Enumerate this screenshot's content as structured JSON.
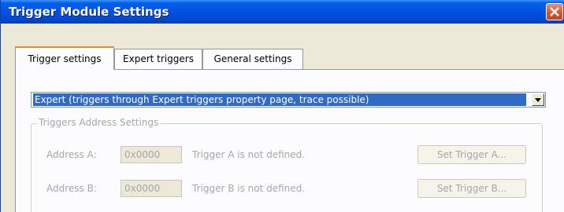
{
  "window": {
    "title": "Trigger Module Settings"
  },
  "tabs": [
    {
      "label": "Trigger settings"
    },
    {
      "label": "Expert triggers"
    },
    {
      "label": "General settings"
    }
  ],
  "mode_select": {
    "value": "Expert (triggers through Expert triggers property page, trace possible)"
  },
  "group": {
    "legend": "Triggers Address Settings"
  },
  "address_a": {
    "label": "Address A:",
    "value": "0x0000",
    "status": "Trigger A is not defined.",
    "button": "Set Trigger A..."
  },
  "address_b": {
    "label": "Address B:",
    "value": "0x0000",
    "status": "Trigger B is not defined.",
    "button": "Set Trigger B..."
  }
}
